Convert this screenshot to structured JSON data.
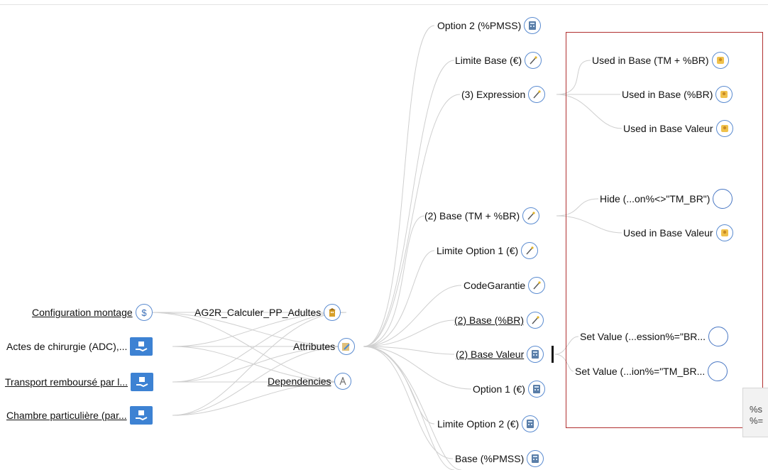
{
  "nodes": {
    "config_montage": "Configuration montage",
    "actes_chirurgie": "Actes de chirurgie (ADC),...",
    "transport": "Transport remboursé par l...",
    "chambre": "Chambre particulière (par...",
    "ag2r": "AG2R_Calculer_PP_Adultes",
    "attributes": "Attributes",
    "dependencies": "Dependencies",
    "option2_pmss": "Option 2 (%PMSS)",
    "limite_base": "Limite Base (€)",
    "expression3": "(3) Expression",
    "base_tm_br": "(2) Base (TM + %BR)",
    "limite_option1": "Limite Option 1 (€)",
    "code_garantie": "CodeGarantie",
    "base_br2": "(2) Base (%BR)",
    "base_valeur2": "(2) Base Valeur",
    "option1": "Option 1 (€)",
    "limite_option2": "Limite Option 2 (€)",
    "base_pmss": "Base (%PMSS)",
    "used_tm_br": "Used in Base (TM + %BR)",
    "used_br": "Used in Base (%BR)",
    "used_valeur_a": "Used in Base Valeur",
    "hide_rule": "Hide (...on%<>\"TM_BR\")",
    "used_valeur_b": "Used in Base Valeur",
    "set_value_1": "Set Value (...ession%=\"BR...",
    "set_value_2": "Set Value (...ion%=\"TM_BR..."
  },
  "side_panel": {
    "line1": "%s",
    "line2": "%="
  },
  "icons": {
    "dollar": "dollar-icon",
    "box_hand": "package-hand-icon",
    "building": "building-icon",
    "pencil": "pencil-icon",
    "compass": "compass-icon",
    "calculator": "calculator-icon",
    "wand": "magic-wand-icon",
    "person": "person-icon",
    "empty": "empty-circle-icon"
  },
  "colors": {
    "highlight_border": "#b03030",
    "icon_border": "#5a8bd0",
    "node_square": "#3d82d3",
    "edge": "#c8c8c8"
  }
}
